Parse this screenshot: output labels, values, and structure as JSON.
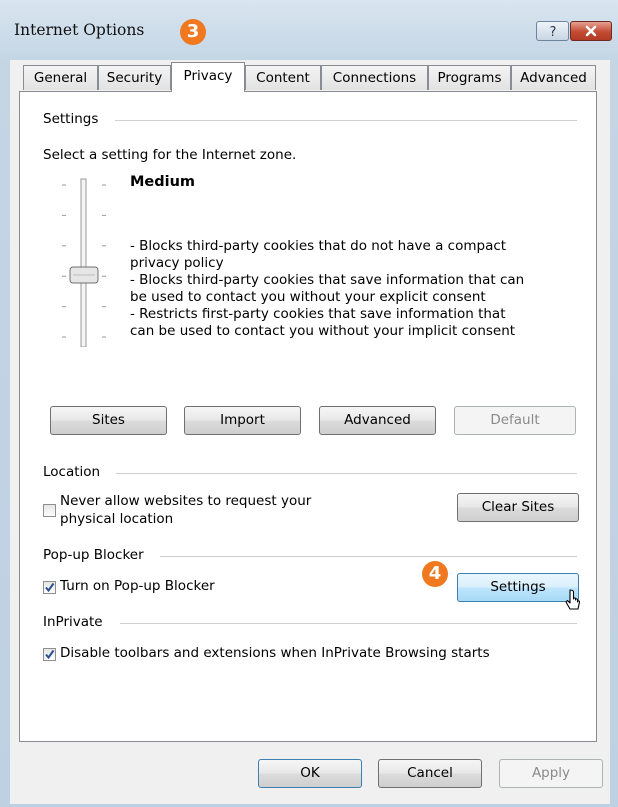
{
  "window": {
    "title": "Internet Options",
    "help_label": "?"
  },
  "annotations": {
    "step3": "3",
    "step4": "4"
  },
  "tabs": [
    {
      "label": "General"
    },
    {
      "label": "Security"
    },
    {
      "label": "Privacy",
      "active": true
    },
    {
      "label": "Content"
    },
    {
      "label": "Connections"
    },
    {
      "label": "Programs"
    },
    {
      "label": "Advanced"
    }
  ],
  "settings": {
    "group_label": "Settings",
    "prompt": "Select a setting for the Internet zone.",
    "level": "Medium",
    "slider_level_fraction": 0.5,
    "description_lines": [
      "- Blocks third-party cookies that do not have a compact",
      "privacy policy",
      "- Blocks third-party cookies that save information that can",
      "be used to contact you without your explicit consent",
      "- Restricts first-party cookies that save information that",
      "can be used to contact you without your implicit consent"
    ],
    "buttons": {
      "sites": "Sites",
      "import": "Import",
      "advanced": "Advanced",
      "default": "Default"
    }
  },
  "location": {
    "group_label": "Location",
    "checkbox_line1": "Never allow websites to request your",
    "checkbox_line2": "physical location",
    "checked": false,
    "clear_sites": "Clear Sites"
  },
  "popup": {
    "group_label": "Pop-up Blocker",
    "checkbox_label": "Turn on Pop-up Blocker",
    "checked": true,
    "settings_button": "Settings"
  },
  "inprivate": {
    "group_label": "InPrivate",
    "checkbox_label": "Disable toolbars and extensions when InPrivate Browsing starts",
    "checked": true
  },
  "footer": {
    "ok": "OK",
    "cancel": "Cancel",
    "apply": "Apply"
  },
  "colors": {
    "accent_badge": "#f0781e",
    "close_button": "#c44a32",
    "checkmark": "#2a4f8f"
  }
}
